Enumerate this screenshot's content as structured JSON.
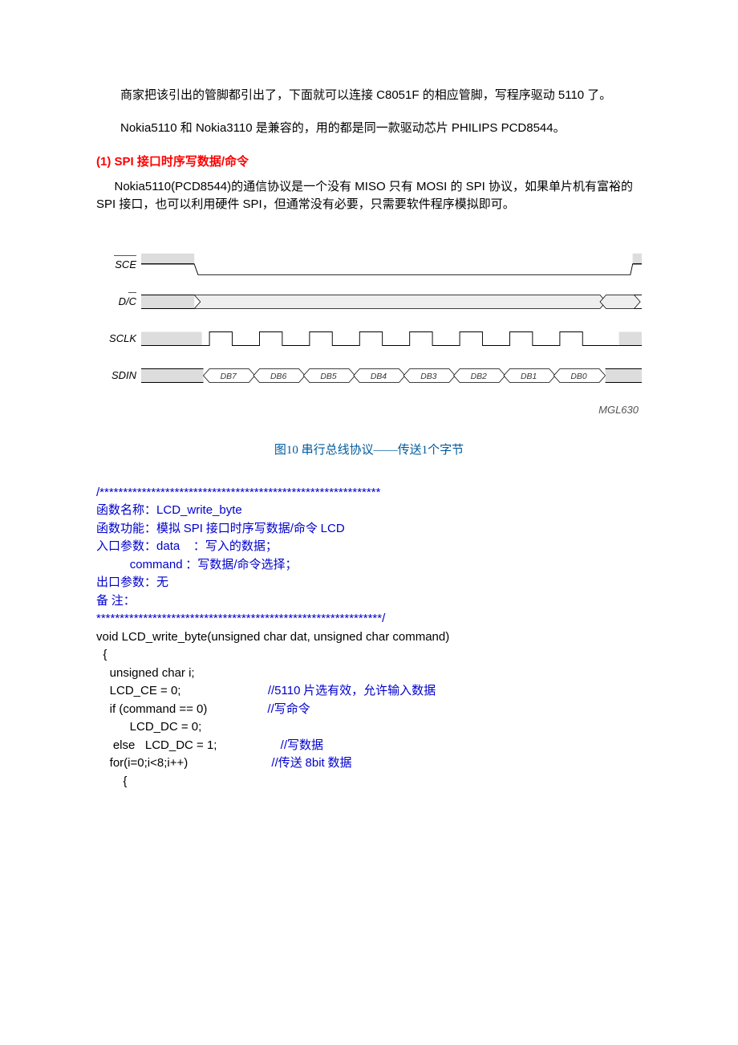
{
  "p1": "商家把该引出的管脚都引出了，下面就可以连接 C8051F 的相应管脚，写程序驱动 5110 了。",
  "p2": "Nokia5110 和 Nokia3110 是兼容的，用的都是同一款驱动芯片 PHILIPS PCD8544。",
  "section1": "(1) SPI 接口时序写数据/命令",
  "p3": "Nokia5110(PCD8544)的通信协议是一个没有 MISO 只有 MOSI 的 SPI 协议，如果单片机有富裕的 SPI 接口，也可以利用硬件 SPI，但通常没有必要，只需要软件程序模拟即可。",
  "signals": {
    "sce": "SCE",
    "dc": "D/C",
    "sclk": "SCLK",
    "sdin": "SDIN"
  },
  "data_bits": [
    "DB7",
    "DB6",
    "DB5",
    "DB4",
    "DB3",
    "DB2",
    "DB1",
    "DB0"
  ],
  "mgl": "MGL630",
  "fig_caption": "图10 串行总线协议——传送1个字节",
  "code": {
    "hr_top": "/************************************************************",
    "l1a": "函数名称：",
    "l1b": "LCD_write_byte",
    "l2a": "函数功能：模拟 ",
    "l2b": "SPI",
    "l2c": " 接口时序写数据",
    "l2d": "/",
    "l2e": "命令 ",
    "l2f": "LCD",
    "l3a": "入口参数：",
    "l3b": "data    ",
    "l3c": "：写入的数据；",
    "l4a": "          ",
    "l4b": "command",
    "l4c": " ：写数据",
    "l4d": "/",
    "l4e": "命令选择；",
    "l5": "出口参数：无",
    "l6": "备 注：",
    "hr_bot": "*************************************************************/",
    "l7": "void LCD_write_byte(unsigned char dat, unsigned char command)",
    "l8": "  {",
    "l9": "    unsigned char i;",
    "l10a": "    LCD_CE = 0;                          ",
    "l10b": "//5110",
    "l10c": " 片选有效，允许输入数据",
    "l11a": "    if (command == 0)                  ",
    "l11b": "//",
    "l11c": "写命令",
    "l12": "          LCD_DC = 0;",
    "l13a": "     else   LCD_DC = 1;                   ",
    "l13b": "//",
    "l13c": "写数据",
    "l14a": "    for(i=0;i<8;i++)                         ",
    "l14b": "//",
    "l14c": "传送 ",
    "l14d": "8bit",
    "l14e": " 数据",
    "l15": "        {"
  }
}
